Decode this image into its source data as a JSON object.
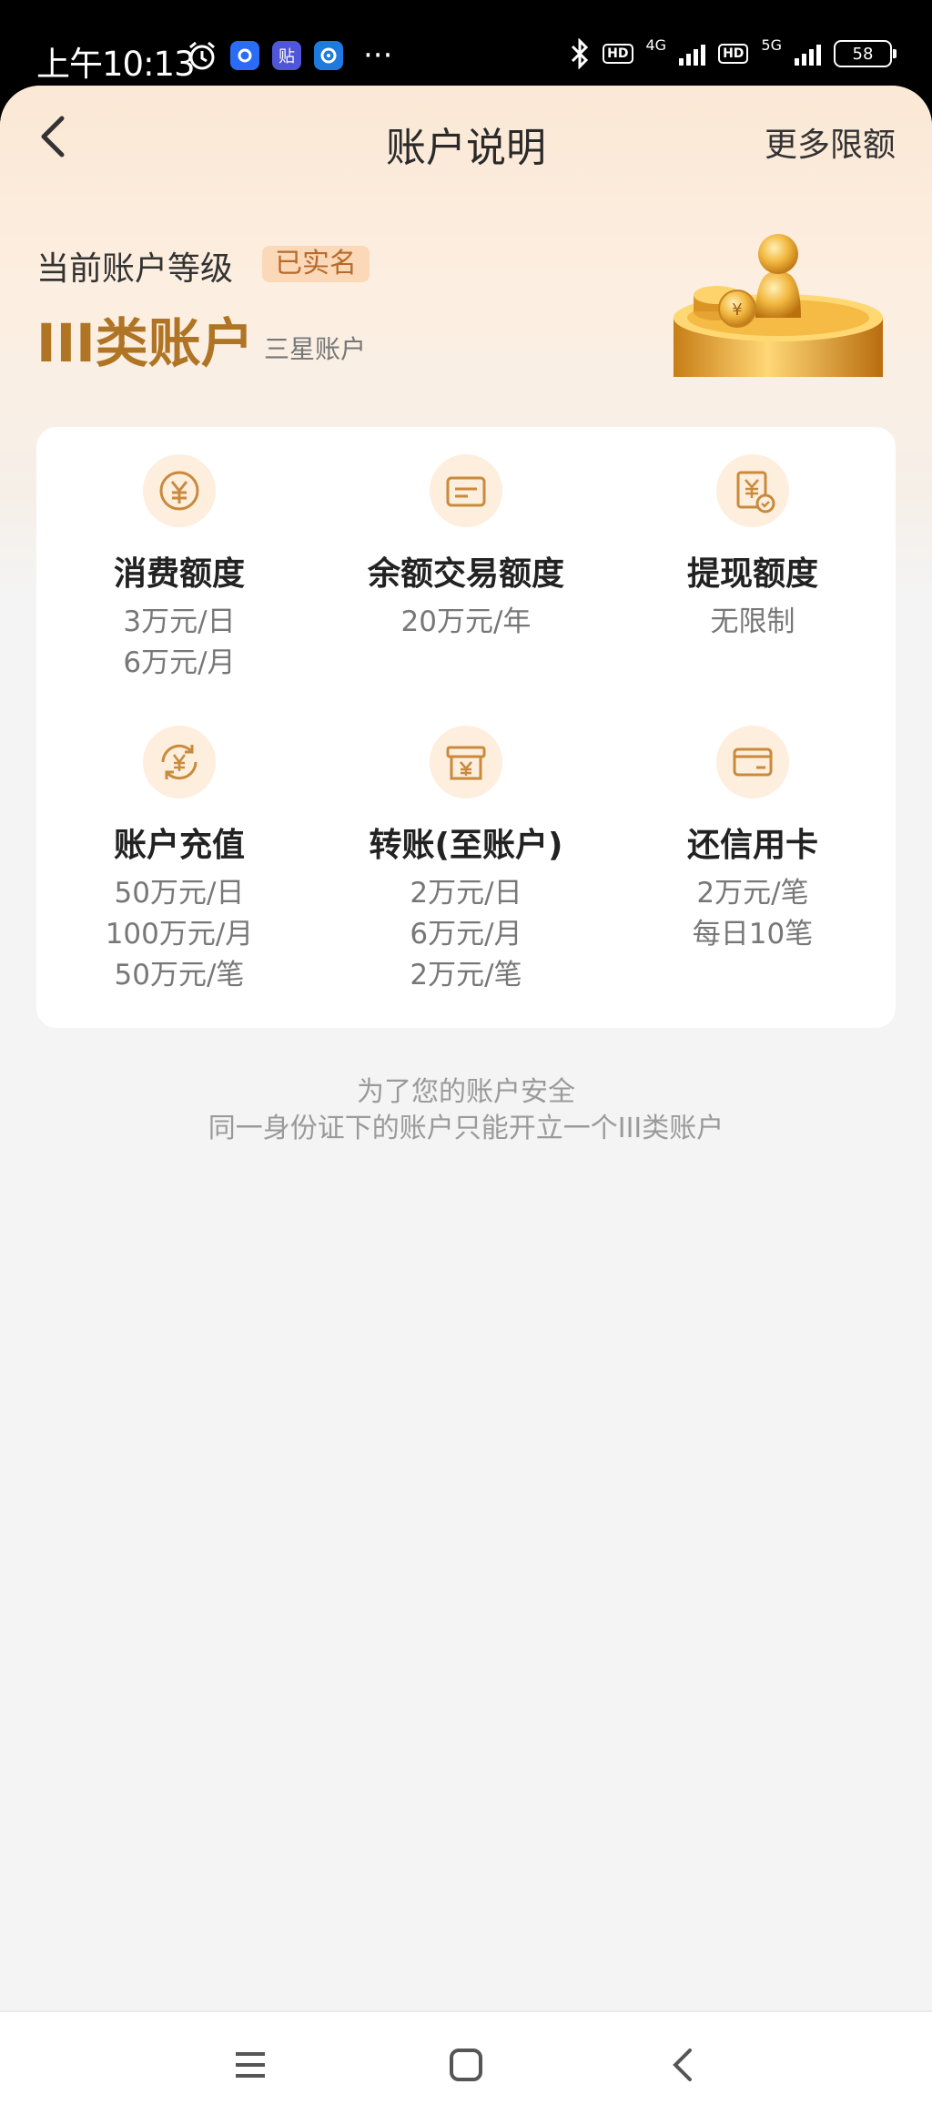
{
  "status_bar": {
    "time": "上午10:13",
    "network_1": "4G",
    "network_2": "5G",
    "battery": "58"
  },
  "nav": {
    "title": "账户说明",
    "more": "更多限额"
  },
  "account": {
    "level_label": "当前账户等级",
    "verified_badge": "已实名",
    "type": "III类账户",
    "star_level": "三星账户"
  },
  "limits": [
    {
      "icon": "yen-coin-icon",
      "title": "消费额度",
      "lines": [
        "3万元/日",
        "6万元/月"
      ]
    },
    {
      "icon": "balance-card-icon",
      "title": "余额交易额度",
      "lines": [
        "20万元/年"
      ]
    },
    {
      "icon": "withdraw-bill-icon",
      "title": "提现额度",
      "lines": [
        "无限制"
      ]
    },
    {
      "icon": "recharge-yen-icon",
      "title": "账户充值",
      "lines": [
        "50万元/日",
        "100万元/月",
        "50万元/笔"
      ]
    },
    {
      "icon": "transfer-box-icon",
      "title": "转账(至账户)",
      "lines": [
        "2万元/日",
        "6万元/月",
        "2万元/笔"
      ]
    },
    {
      "icon": "credit-card-icon",
      "title": "还信用卡",
      "lines": [
        "2万元/笔",
        "每日10笔"
      ]
    }
  ],
  "security_note": {
    "line1": "为了您的账户安全",
    "line2": "同一身份证下的账户只能开立一个III类账户"
  },
  "colors": {
    "accent_gold": "#b07524",
    "badge_bg": "#fbd9b8",
    "badge_text": "#b86a2c",
    "icon_bg": "#fdeedd",
    "icon_stroke": "#c98a3c"
  }
}
